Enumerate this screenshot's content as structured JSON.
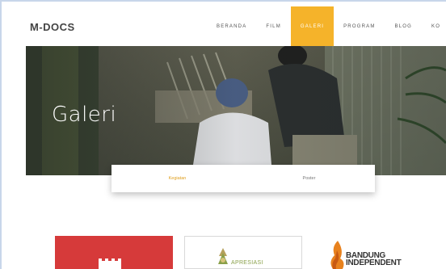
{
  "brand": {
    "logo": "M-DOCS"
  },
  "nav": {
    "items": [
      {
        "label": "BERANDA"
      },
      {
        "label": "FILM"
      },
      {
        "label": "GALERI"
      },
      {
        "label": "PROGRAM"
      },
      {
        "label": "BLOG"
      },
      {
        "label": "KO"
      }
    ],
    "active_label": "GALERI"
  },
  "hero": {
    "title": "Galeri"
  },
  "tabs": {
    "items": [
      {
        "label": "Kegiatan"
      },
      {
        "label": "Poster"
      }
    ],
    "active_label": "Kegiatan"
  },
  "partners": {
    "apresiasi": "APRESIASI",
    "bandung_line1": "BANDUNG",
    "bandung_line2": "INDEPENDENT"
  },
  "colors": {
    "accent": "#f5b32a",
    "partner_red": "#d63a3a"
  }
}
